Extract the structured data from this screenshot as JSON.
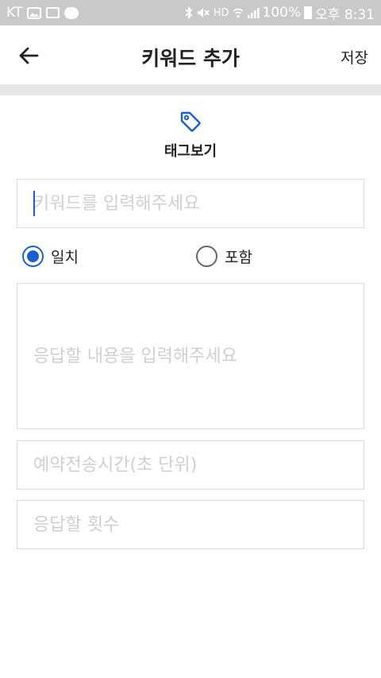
{
  "status_bar": {
    "carrier": "KT",
    "hd_label": "HD",
    "battery_text": "100%",
    "time": "오후 8:31"
  },
  "app_bar": {
    "title": "키워드 추가",
    "save_label": "저장"
  },
  "tag_view": {
    "label": "태그보기"
  },
  "keyword_input": {
    "value": "",
    "placeholder": "키워드를 입력해주세요"
  },
  "match_options": {
    "exact_label": "일치",
    "contains_label": "포함",
    "selected": "exact"
  },
  "response_input": {
    "value": "",
    "placeholder": "응답할 내용을 입력해주세요"
  },
  "time_input": {
    "value": "",
    "placeholder": "예약전송시간(초 단위)"
  },
  "count_input": {
    "value": "",
    "placeholder": "응답할 횟수"
  },
  "colors": {
    "accent": "#1a5fd0",
    "status_bar_bg": "#c9c9c9",
    "divider": "#e6e6e6",
    "field_border": "#dcdcdc",
    "placeholder": "#cfcfcf"
  }
}
